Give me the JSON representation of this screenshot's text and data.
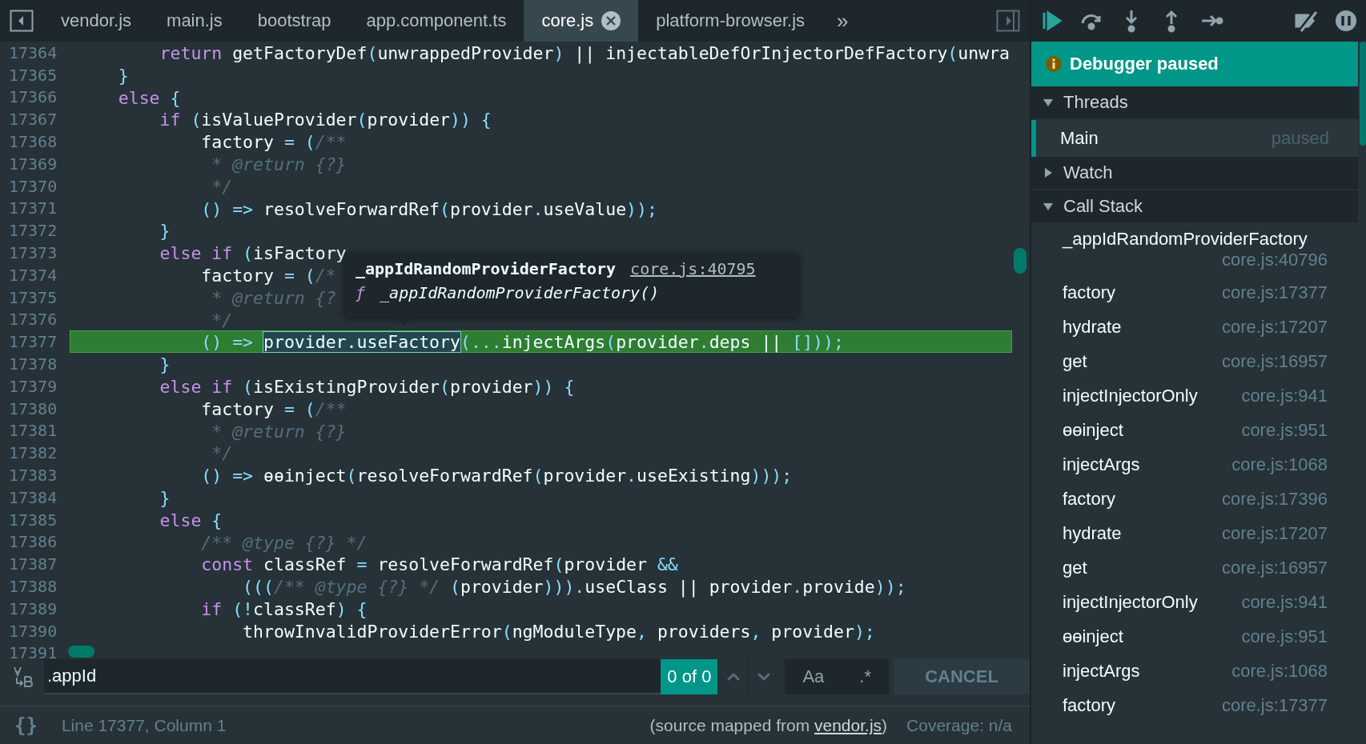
{
  "tabs": [
    {
      "label": "vendor.js",
      "selected": false
    },
    {
      "label": "main.js",
      "selected": false
    },
    {
      "label": "bootstrap",
      "selected": false
    },
    {
      "label": "app.component.ts",
      "selected": false
    },
    {
      "label": "core.js",
      "selected": true
    },
    {
      "label": "platform-browser.js",
      "selected": false
    }
  ],
  "tab_overflow": "»",
  "code_lines": [
    {
      "number": "17364",
      "current": false,
      "tokens": [
        {
          "kind": "k",
          "text": "        return"
        },
        {
          "kind": "t",
          "text": " getFactoryDef"
        },
        {
          "kind": "p",
          "text": "("
        },
        {
          "kind": "t",
          "text": "unwrappedProvider"
        },
        {
          "kind": "p",
          "text": ")"
        },
        {
          "kind": "t",
          "text": " || injectableDefOrInjectorDefFactory"
        },
        {
          "kind": "p",
          "text": "("
        },
        {
          "kind": "t",
          "text": "unwra"
        }
      ]
    },
    {
      "number": "17365",
      "current": false,
      "tokens": [
        {
          "kind": "p",
          "text": "    }"
        }
      ]
    },
    {
      "number": "17366",
      "current": false,
      "tokens": [
        {
          "kind": "k",
          "text": "    else"
        },
        {
          "kind": "p",
          "text": " {"
        }
      ]
    },
    {
      "number": "17367",
      "current": false,
      "tokens": [
        {
          "kind": "k",
          "text": "        if"
        },
        {
          "kind": "p",
          "text": " ("
        },
        {
          "kind": "t",
          "text": "isValueProvider"
        },
        {
          "kind": "p",
          "text": "("
        },
        {
          "kind": "t",
          "text": "provider"
        },
        {
          "kind": "p",
          "text": ")) {"
        }
      ]
    },
    {
      "number": "17368",
      "current": false,
      "tokens": [
        {
          "kind": "t",
          "text": "            factory"
        },
        {
          "kind": "p",
          "text": " = ("
        },
        {
          "kind": "c",
          "text": "/**"
        }
      ]
    },
    {
      "number": "17369",
      "current": false,
      "tokens": [
        {
          "kind": "c",
          "text": "             * @return {?}"
        }
      ]
    },
    {
      "number": "17370",
      "current": false,
      "tokens": [
        {
          "kind": "c",
          "text": "             */"
        }
      ]
    },
    {
      "number": "17371",
      "current": false,
      "tokens": [
        {
          "kind": "p",
          "text": "            () =>"
        },
        {
          "kind": "t",
          "text": " resolveForwardRef"
        },
        {
          "kind": "p",
          "text": "("
        },
        {
          "kind": "t",
          "text": "provider"
        },
        {
          "kind": "p",
          "text": "."
        },
        {
          "kind": "t",
          "text": "useValue"
        },
        {
          "kind": "p",
          "text": "));"
        }
      ]
    },
    {
      "number": "17372",
      "current": false,
      "tokens": [
        {
          "kind": "p",
          "text": "        }"
        }
      ]
    },
    {
      "number": "17373",
      "current": false,
      "tokens": [
        {
          "kind": "k",
          "text": "        else if"
        },
        {
          "kind": "p",
          "text": " ("
        },
        {
          "kind": "t",
          "text": "isFactory"
        }
      ]
    },
    {
      "number": "17374",
      "current": false,
      "tokens": [
        {
          "kind": "t",
          "text": "            factory"
        },
        {
          "kind": "p",
          "text": " = ("
        },
        {
          "kind": "c",
          "text": "/*"
        }
      ]
    },
    {
      "number": "17375",
      "current": false,
      "tokens": [
        {
          "kind": "c",
          "text": "             * @return {?"
        }
      ]
    },
    {
      "number": "17376",
      "current": false,
      "tokens": [
        {
          "kind": "c",
          "text": "             */"
        }
      ]
    },
    {
      "number": "17377",
      "current": true,
      "tokens": [
        {
          "kind": "p",
          "text": "            () => "
        },
        {
          "kind": "s",
          "text": "provider.useFactory"
        },
        {
          "kind": "p",
          "text": "(..."
        },
        {
          "kind": "t",
          "text": "injectArgs"
        },
        {
          "kind": "p",
          "text": "("
        },
        {
          "kind": "t",
          "text": "provider"
        },
        {
          "kind": "p",
          "text": "."
        },
        {
          "kind": "t",
          "text": "deps || "
        },
        {
          "kind": "p",
          "text": "[]));"
        }
      ]
    },
    {
      "number": "17378",
      "current": false,
      "tokens": [
        {
          "kind": "p",
          "text": "        }"
        }
      ]
    },
    {
      "number": "17379",
      "current": false,
      "tokens": [
        {
          "kind": "k",
          "text": "        else if"
        },
        {
          "kind": "p",
          "text": " ("
        },
        {
          "kind": "t",
          "text": "isExistingProvider"
        },
        {
          "kind": "p",
          "text": "("
        },
        {
          "kind": "t",
          "text": "provider"
        },
        {
          "kind": "p",
          "text": ")) {"
        }
      ]
    },
    {
      "number": "17380",
      "current": false,
      "tokens": [
        {
          "kind": "t",
          "text": "            factory"
        },
        {
          "kind": "p",
          "text": " = ("
        },
        {
          "kind": "c",
          "text": "/**"
        }
      ]
    },
    {
      "number": "17381",
      "current": false,
      "tokens": [
        {
          "kind": "c",
          "text": "             * @return {?}"
        }
      ]
    },
    {
      "number": "17382",
      "current": false,
      "tokens": [
        {
          "kind": "c",
          "text": "             */"
        }
      ]
    },
    {
      "number": "17383",
      "current": false,
      "tokens": [
        {
          "kind": "p",
          "text": "            () =>"
        },
        {
          "kind": "t",
          "text": " ɵɵinject"
        },
        {
          "kind": "p",
          "text": "("
        },
        {
          "kind": "t",
          "text": "resolveForwardRef"
        },
        {
          "kind": "p",
          "text": "("
        },
        {
          "kind": "t",
          "text": "provider"
        },
        {
          "kind": "p",
          "text": "."
        },
        {
          "kind": "t",
          "text": "useExisting"
        },
        {
          "kind": "p",
          "text": ")));"
        }
      ]
    },
    {
      "number": "17384",
      "current": false,
      "tokens": [
        {
          "kind": "p",
          "text": "        }"
        }
      ]
    },
    {
      "number": "17385",
      "current": false,
      "tokens": [
        {
          "kind": "k",
          "text": "        else"
        },
        {
          "kind": "p",
          "text": " {"
        }
      ]
    },
    {
      "number": "17386",
      "current": false,
      "tokens": [
        {
          "kind": "c",
          "text": "            /** @type {?} */"
        }
      ]
    },
    {
      "number": "17387",
      "current": false,
      "tokens": [
        {
          "kind": "k",
          "text": "            const"
        },
        {
          "kind": "t",
          "text": " classRef"
        },
        {
          "kind": "p",
          "text": " ="
        },
        {
          "kind": "t",
          "text": " resolveForwardRef"
        },
        {
          "kind": "p",
          "text": "("
        },
        {
          "kind": "t",
          "text": "provider"
        },
        {
          "kind": "p",
          "text": " &&"
        }
      ]
    },
    {
      "number": "17388",
      "current": false,
      "tokens": [
        {
          "kind": "p",
          "text": "                ((("
        },
        {
          "kind": "c",
          "text": "/** @type {?} */"
        },
        {
          "kind": "p",
          "text": " ("
        },
        {
          "kind": "t",
          "text": "provider"
        },
        {
          "kind": "p",
          "text": ")))."
        },
        {
          "kind": "t",
          "text": "useClass || provider"
        },
        {
          "kind": "p",
          "text": "."
        },
        {
          "kind": "t",
          "text": "provide"
        },
        {
          "kind": "p",
          "text": "));"
        }
      ]
    },
    {
      "number": "17389",
      "current": false,
      "tokens": [
        {
          "kind": "k",
          "text": "            if"
        },
        {
          "kind": "p",
          "text": " (!"
        },
        {
          "kind": "t",
          "text": "classRef"
        },
        {
          "kind": "p",
          "text": ") {"
        }
      ]
    },
    {
      "number": "17390",
      "current": false,
      "tokens": [
        {
          "kind": "t",
          "text": "                throwInvalidProviderError"
        },
        {
          "kind": "p",
          "text": "("
        },
        {
          "kind": "t",
          "text": "ngModuleType"
        },
        {
          "kind": "p",
          "text": ","
        },
        {
          "kind": "t",
          "text": " providers"
        },
        {
          "kind": "p",
          "text": ","
        },
        {
          "kind": "t",
          "text": " provider"
        },
        {
          "kind": "p",
          "text": ");"
        }
      ]
    },
    {
      "number": "17391",
      "current": false
    }
  ],
  "tooltip": {
    "name": "_appIdRandomProviderFactory",
    "location": "core.js:40795",
    "symbol": "ƒ",
    "signature": "_appIdRandomProviderFactory()"
  },
  "search": {
    "value": ".appId",
    "match_count": "0 of 0",
    "case_label": "Aa",
    "regex_label": ".*",
    "cancel": "CANCEL"
  },
  "status_bar": {
    "pretty_print": "{}",
    "position": "Line 17377, Column 1",
    "source_prefix": "(source mapped from ",
    "source_link": "vendor.js",
    "source_suffix": ")",
    "coverage": "Coverage: n/a"
  },
  "debugger": {
    "banner": "Debugger paused",
    "sections": [
      {
        "kind": "threads",
        "title": "Threads",
        "expanded": true,
        "items": [
          {
            "name": "Main",
            "status": "paused",
            "selected": true
          }
        ]
      },
      {
        "kind": "watch",
        "title": "Watch",
        "expanded": false
      },
      {
        "kind": "call_stack",
        "title": "Call Stack",
        "expanded": true,
        "frames": [
          {
            "name": "_appIdRandomProviderFactory",
            "location": "core.js:40796"
          },
          {
            "name": "factory",
            "location": "core.js:17377"
          },
          {
            "name": "hydrate",
            "location": "core.js:17207"
          },
          {
            "name": "get",
            "location": "core.js:16957"
          },
          {
            "name": "injectInjectorOnly",
            "location": "core.js:941"
          },
          {
            "name": "ɵɵinject",
            "location": "core.js:951"
          },
          {
            "name": "injectArgs",
            "location": "core.js:1068"
          },
          {
            "name": "factory",
            "location": "core.js:17396"
          },
          {
            "name": "hydrate",
            "location": "core.js:17207"
          },
          {
            "name": "get",
            "location": "core.js:16957"
          },
          {
            "name": "injectInjectorOnly",
            "location": "core.js:941"
          },
          {
            "name": "ɵɵinject",
            "location": "core.js:951"
          },
          {
            "name": "injectArgs",
            "location": "core.js:1068"
          },
          {
            "name": "factory",
            "location": "core.js:17377"
          }
        ]
      }
    ]
  }
}
